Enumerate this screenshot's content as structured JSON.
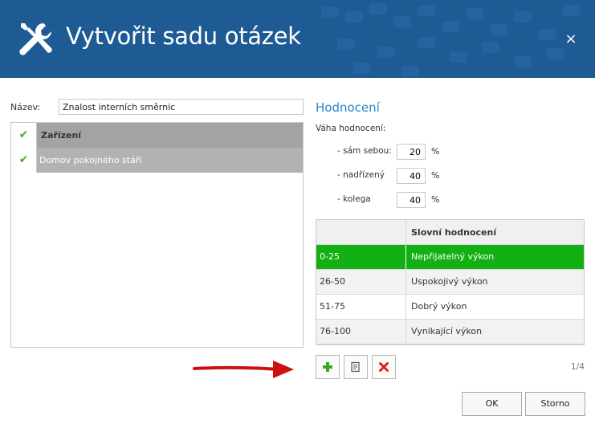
{
  "dialog": {
    "title": "Vytvořit sadu otázek",
    "close": "×"
  },
  "name_field": {
    "label": "Název:",
    "value": "Znalost interních směrnic"
  },
  "left_list": {
    "header": "Zařízení",
    "rows": [
      {
        "label": "Domov pokojného stáří",
        "checked": true
      }
    ]
  },
  "rating": {
    "title": "Hodnocení",
    "weight_label": "Váha hodnocení:",
    "weights": [
      {
        "label": "- sám sebou:",
        "value": "20",
        "unit": "%"
      },
      {
        "label": "- nadřízený",
        "value": "40",
        "unit": "%"
      },
      {
        "label": "- kolega",
        "value": "40",
        "unit": "%"
      }
    ],
    "table": {
      "columns": [
        "",
        "Slovní hodnocení"
      ],
      "rows": [
        {
          "range": "0-25",
          "label": "Nepřijatelný výkon"
        },
        {
          "range": "26-50",
          "label": "Uspokojivý výkon"
        },
        {
          "range": "51-75",
          "label": "Dobrý výkon"
        },
        {
          "range": "76-100",
          "label": "Vynikající výkon"
        }
      ]
    },
    "toolbar": {
      "add_icon": "plus-icon",
      "edit_icon": "edit-icon",
      "delete_icon": "delete-icon"
    },
    "page": "1/4"
  },
  "buttons": {
    "ok": "OK",
    "cancel": "Storno"
  },
  "colors": {
    "header": "#1e5b94",
    "selected_row": "#13b013",
    "accent_title": "#1e88c8",
    "check": "#4caf1e",
    "arrow": "#cc1111"
  }
}
